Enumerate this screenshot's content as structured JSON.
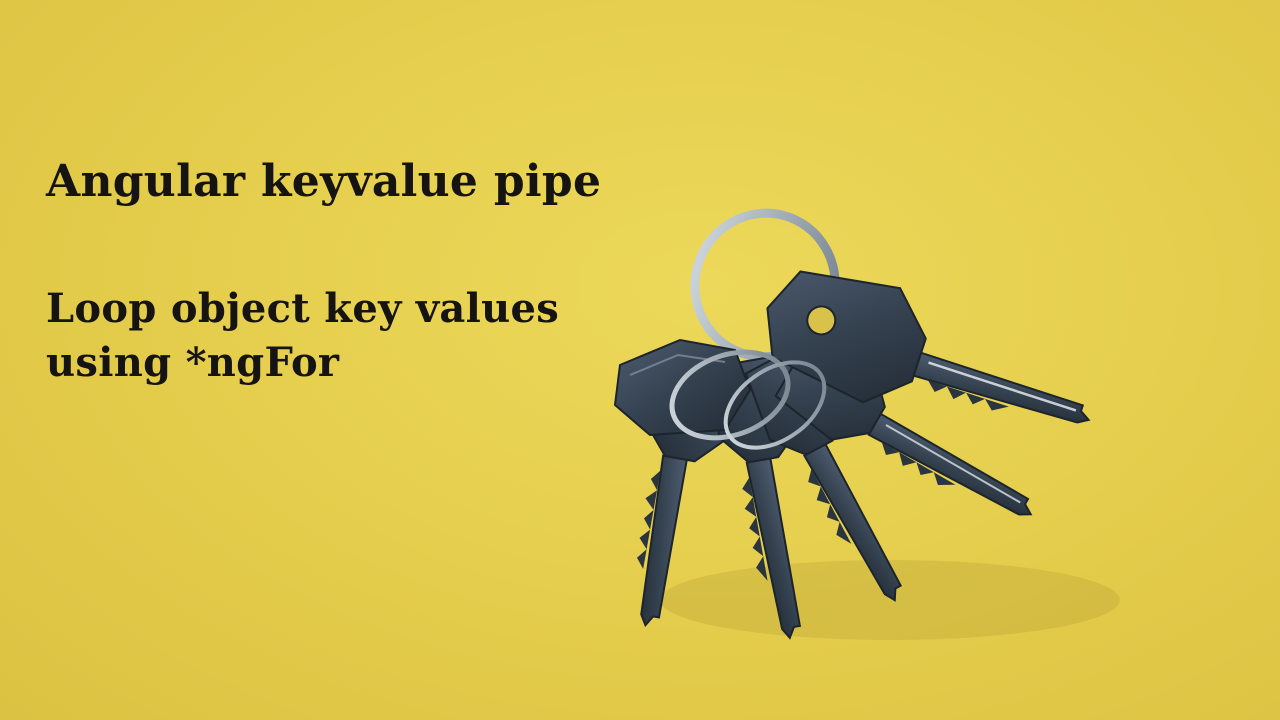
{
  "heading": {
    "title": "Angular keyvalue pipe",
    "subtitle_line1": "Loop object key values",
    "subtitle_line2": "using *ngFor"
  },
  "image": {
    "subject_icon": "keyring-with-keys-icon",
    "background_color": "#e6cf4e",
    "key_color": "#3b4a5c",
    "ring_color": "#9aa4ad"
  }
}
